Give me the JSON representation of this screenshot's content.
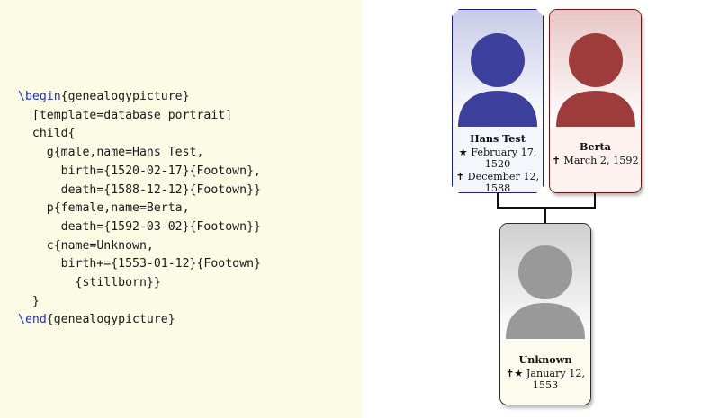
{
  "code_lines": [
    {
      "parts": [
        {
          "t": "\\begin",
          "kw": true
        },
        {
          "t": "{genealogypicture}"
        }
      ]
    },
    {
      "parts": [
        {
          "t": "  [template=database portrait]"
        }
      ]
    },
    {
      "parts": [
        {
          "t": "  child{"
        }
      ]
    },
    {
      "parts": [
        {
          "t": "    g{male,name=Hans Test,"
        }
      ]
    },
    {
      "parts": [
        {
          "t": "      birth={1520-02-17}{Footown},"
        }
      ]
    },
    {
      "parts": [
        {
          "t": "      death={1588-12-12}{Footown}}"
        }
      ]
    },
    {
      "parts": [
        {
          "t": "    p{female,name=Berta,"
        }
      ]
    },
    {
      "parts": [
        {
          "t": "      death={1592-03-02}{Footown}}"
        }
      ]
    },
    {
      "parts": [
        {
          "t": "    c{name=Unknown,"
        }
      ]
    },
    {
      "parts": [
        {
          "t": "      birth+={1553-01-12}{Footown}"
        }
      ]
    },
    {
      "parts": [
        {
          "t": "        {stillborn}}"
        }
      ]
    },
    {
      "parts": [
        {
          "t": "  }"
        }
      ]
    },
    {
      "parts": [
        {
          "t": "\\end",
          "kw": true
        },
        {
          "t": "{genealogypicture}"
        }
      ]
    }
  ],
  "colors": {
    "keyword": "#1c2fd4",
    "male": "#3c3f9c",
    "female": "#9e3b3b",
    "neutral": "#999999"
  },
  "people": {
    "hans": {
      "name": "Hans Test",
      "birth_symbol": "★",
      "birth_text": "February 17, 1520",
      "death_symbol": "✝",
      "death_text": "December 12, 1588",
      "portrait_icon": "person-silhouette-icon"
    },
    "berta": {
      "name": "Berta",
      "death_symbol": "✝",
      "death_text": "March 2, 1592",
      "portrait_icon": "person-silhouette-icon"
    },
    "unknown": {
      "name": "Unknown",
      "event_symbol": "✝★",
      "event_text": "January 12, 1553",
      "portrait_icon": "person-silhouette-icon"
    }
  }
}
